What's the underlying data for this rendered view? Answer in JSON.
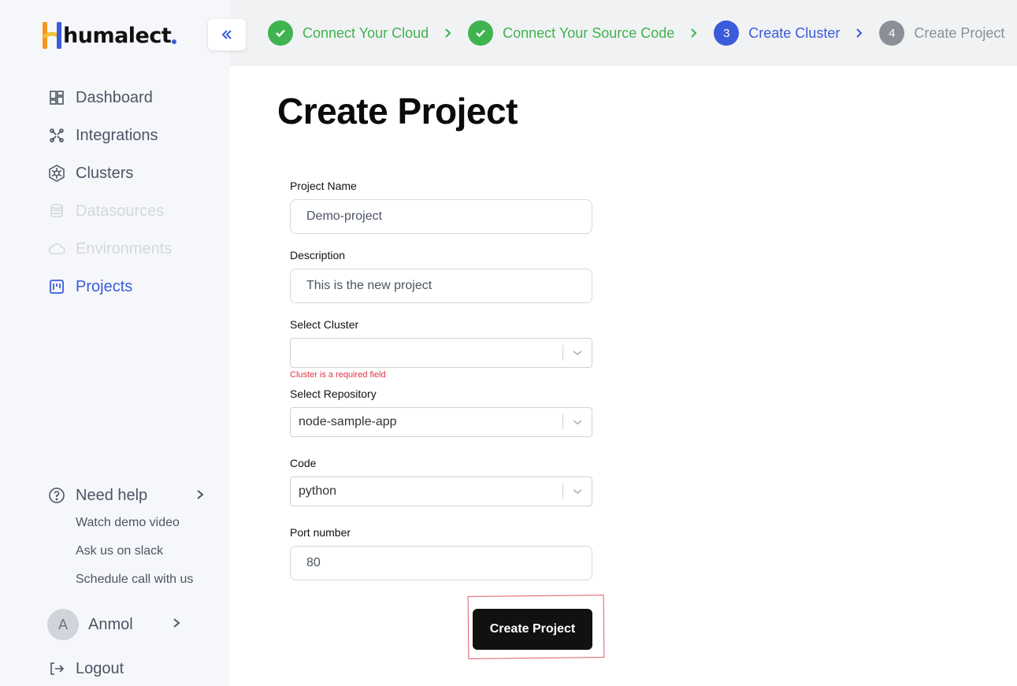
{
  "brand": {
    "name": "humalect",
    "accent": "#3b5bdb"
  },
  "sidebar": {
    "collapse_icon": "double-chevron-left-icon",
    "items": [
      {
        "label": "Dashboard",
        "icon": "dashboard-icon",
        "state": "normal"
      },
      {
        "label": "Integrations",
        "icon": "integrations-icon",
        "state": "normal"
      },
      {
        "label": "Clusters",
        "icon": "cluster-icon",
        "state": "normal"
      },
      {
        "label": "Datasources",
        "icon": "database-icon",
        "state": "disabled"
      },
      {
        "label": "Environments",
        "icon": "cloud-icon",
        "state": "disabled"
      },
      {
        "label": "Projects",
        "icon": "projects-icon",
        "state": "active"
      }
    ],
    "help": {
      "title": "Need help",
      "links": [
        "Watch demo video",
        "Ask us on slack",
        "Schedule call with us"
      ]
    },
    "user": {
      "initial": "A",
      "name": "Anmol"
    },
    "logout_label": "Logout"
  },
  "stepper": {
    "steps": [
      {
        "label": "Connect Your Cloud",
        "status": "done",
        "number": ""
      },
      {
        "label": "Connect Your Source Code",
        "status": "done",
        "number": ""
      },
      {
        "label": "Create Cluster",
        "status": "current",
        "number": "3"
      },
      {
        "label": "Create Project",
        "status": "todo",
        "number": "4"
      }
    ],
    "colors": {
      "done": "#3fb34f",
      "current": "#3b5bdb",
      "todo": "#8b8f98"
    }
  },
  "main": {
    "title": "Create Project",
    "form": {
      "project_name": {
        "label": "Project Name",
        "value": "Demo-project"
      },
      "description": {
        "label": "Description",
        "value": "This is the new project"
      },
      "cluster": {
        "label": "Select Cluster",
        "value": "",
        "error": "Cluster is a required field"
      },
      "repository": {
        "label": "Select Repository",
        "value": "node-sample-app"
      },
      "code": {
        "label": "Code",
        "value": "python"
      },
      "port": {
        "label": "Port number",
        "value": "80"
      }
    },
    "submit_label": "Create Project"
  }
}
